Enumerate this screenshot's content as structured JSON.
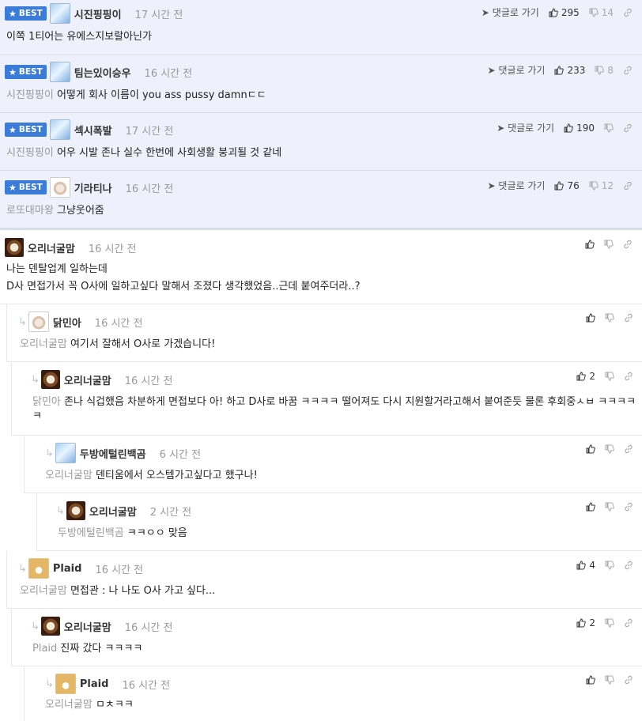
{
  "labels": {
    "best": "BEST",
    "goto_reply": "댓글로 가기"
  },
  "best_comments": [
    {
      "nick": "시진핑핑이",
      "time": "17 시간 전",
      "mention": "",
      "text": "이쪽 1티어는 유에스지보랄아닌가",
      "up": "295",
      "down": "14",
      "avatar": "ice-icon"
    },
    {
      "nick": "팀는있이승우",
      "time": "16 시간 전",
      "mention": "시진핑핑이",
      "text": "어떻게 회사 이름이 you ass pussy damnㄷㄷ",
      "up": "233",
      "down": "8",
      "avatar": "ice-icon"
    },
    {
      "nick": "섹시폭발",
      "time": "17 시간 전",
      "mention": "시진핑핑이",
      "text": "어우 시발 존나 실수 한번에 사회생활 붕괴될 것 같네",
      "up": "190",
      "down": "",
      "avatar": "ice-icon"
    },
    {
      "nick": "기라티나",
      "time": "16 시간 전",
      "mention": "로또대마왕",
      "text": "그냥웃어줌",
      "up": "76",
      "down": "12",
      "avatar": "dog-icon"
    }
  ],
  "comments": [
    {
      "nick": "오리너굴맘",
      "time": "16 시간 전",
      "mention": "",
      "text_line1": "나는 덴탈업계 일하는데",
      "text_line2": "D사 면접가서 꼭 O사에 일하고싶다 말해서 조졌다 생각했었음..근데 붙여주더라..?",
      "up": "",
      "avatar": "lion-icon"
    },
    {
      "nick": "닭민아",
      "time": "16 시간 전",
      "mention": "오리너굴맘",
      "text": "여기서 잘해서 O사로 가겠습니다!",
      "up": "",
      "avatar": "dog-icon"
    },
    {
      "nick": "오리너굴맘",
      "time": "16 시간 전",
      "mention": "닭민아",
      "text": "존나 식겁했음 차분하게 면접보다 아! 하고 D사로 바꿈 ㅋㅋㅋㅋ 떨어져도 다시 지원할거라고해서 붙여준듯 물론 후회중ㅅㅂ ㅋㅋㅋㅋㅋ",
      "up": "2",
      "avatar": "lion-icon"
    },
    {
      "nick": "두방에털린백곰",
      "time": "6 시간 전",
      "mention": "오리너굴맘",
      "text": "덴티움에서 오스템가고싶다고 했구나!",
      "up": "",
      "avatar": "ice-icon"
    },
    {
      "nick": "오리너굴맘",
      "time": "2 시간 전",
      "mention": "두방에털린백곰",
      "text": "ㅋㅋㅇㅇ 맞음",
      "up": "",
      "avatar": "lion-icon"
    },
    {
      "nick": "Plaid",
      "time": "16 시간 전",
      "mention": "오리너굴맘",
      "text": "면접관 : 나 나도 O사 가고 싶다...",
      "up": "4",
      "avatar": "fox-icon"
    },
    {
      "nick": "오리너굴맘",
      "time": "16 시간 전",
      "mention": "Plaid",
      "text": "진짜 갔다 ㅋㅋㅋㅋ",
      "up": "2",
      "avatar": "lion-icon"
    },
    {
      "nick": "Plaid",
      "time": "16 시간 전",
      "mention": "오리너굴맘",
      "text": "ㅁㅊㅋㅋ",
      "up": "",
      "avatar": "fox-icon"
    }
  ]
}
